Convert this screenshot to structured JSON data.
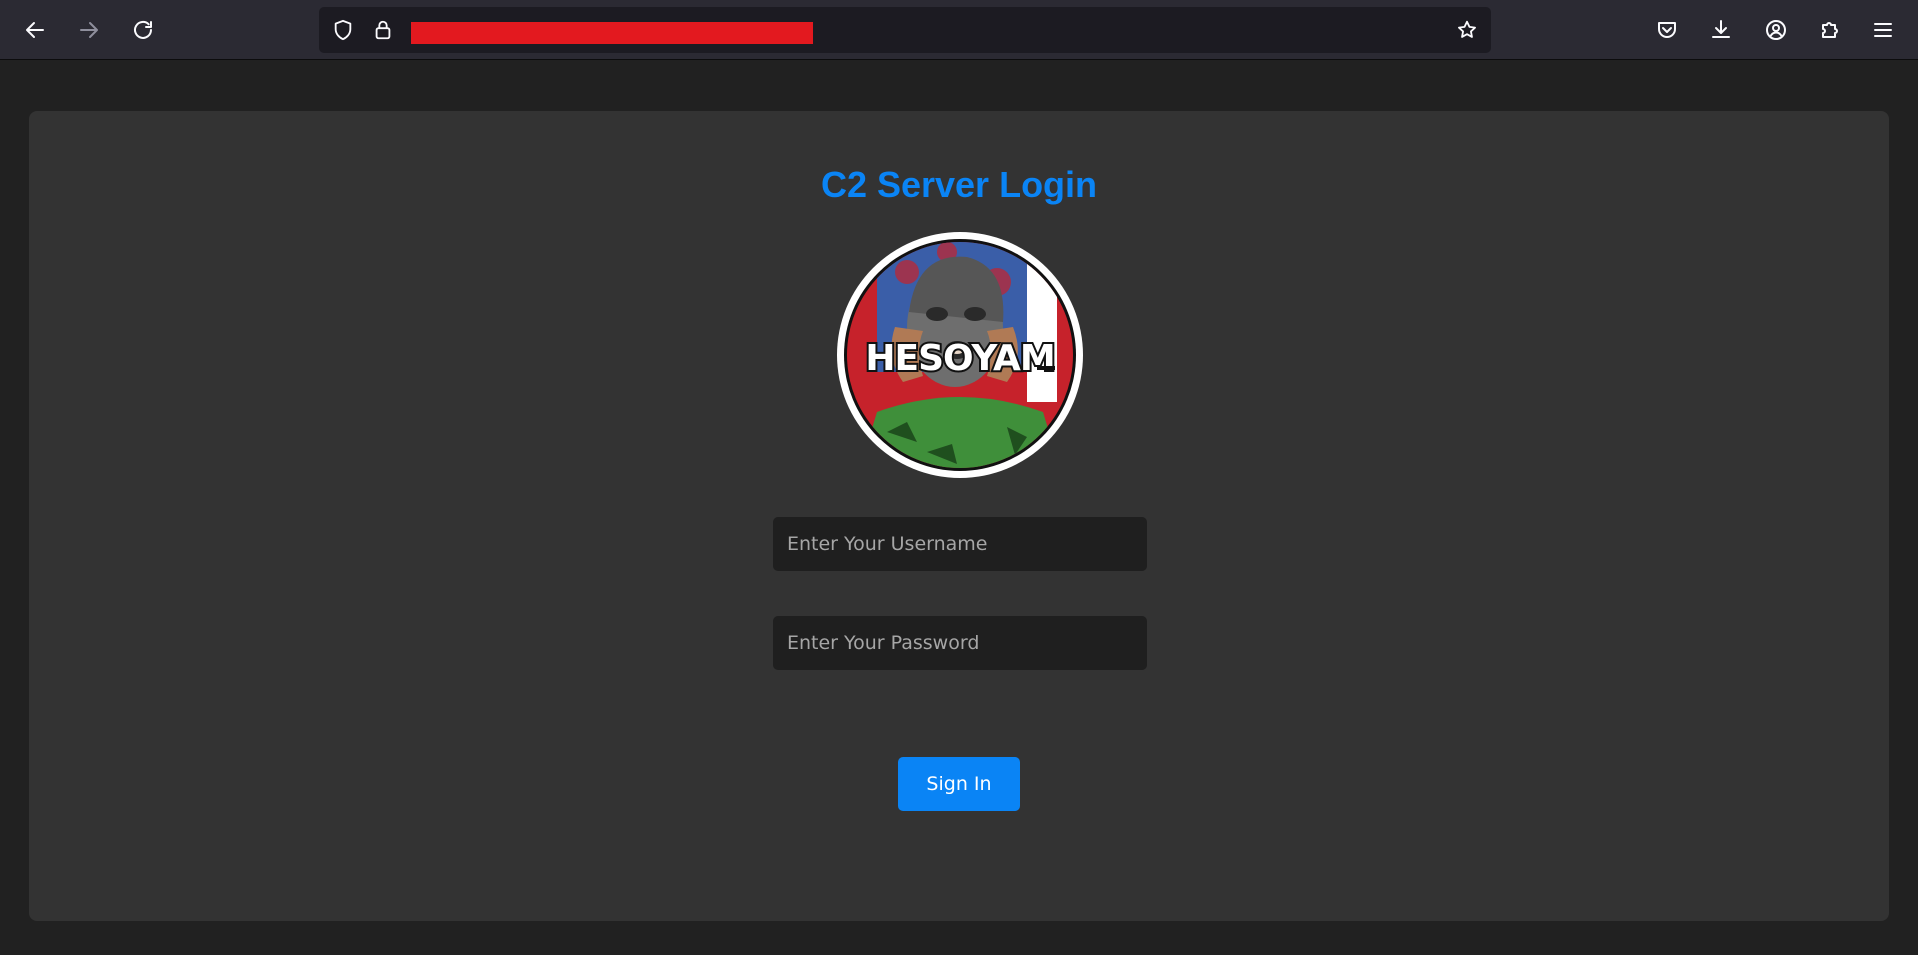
{
  "browser": {
    "url": "",
    "icons": {
      "back": "arrow-left-icon",
      "forward": "arrow-right-icon",
      "reload": "reload-icon",
      "tracking": "shield-icon",
      "lock": "lock-icon",
      "bookmark": "star-icon",
      "pocket": "pocket-icon",
      "downloads": "download-icon",
      "account": "account-icon",
      "extensions": "puzzle-icon",
      "menu": "hamburger-menu-icon"
    },
    "colors": {
      "toolbar": "#2b2a33",
      "urlbar": "#1c1b22",
      "redaction": "#e3191f"
    }
  },
  "page": {
    "title": "C2 Server Login",
    "logo_text": "HESOYAM",
    "username": {
      "placeholder": "Enter Your Username",
      "value": ""
    },
    "password": {
      "placeholder": "Enter Your Password",
      "value": ""
    },
    "submit_label": "Sign In",
    "colors": {
      "accent": "#0a84f5",
      "card": "#333333",
      "background": "#212121"
    }
  }
}
